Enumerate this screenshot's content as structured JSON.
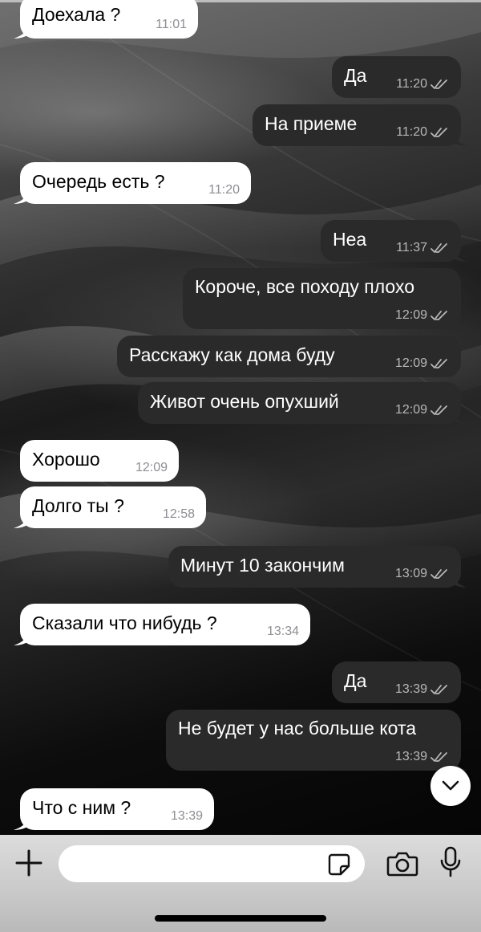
{
  "chat": {
    "messages": [
      {
        "dir": "in",
        "text": "Доехала ?",
        "time": "11:01"
      },
      {
        "dir": "out",
        "text": "Да",
        "time": "11:20"
      },
      {
        "dir": "out",
        "text": "На приеме",
        "time": "11:20"
      },
      {
        "dir": "in",
        "text": "Очередь есть ?",
        "time": "11:20"
      },
      {
        "dir": "out",
        "text": "Неа",
        "time": "11:37"
      },
      {
        "dir": "out",
        "text": "Короче, все походу плохо",
        "time": "12:09"
      },
      {
        "dir": "out",
        "text": "Расскажу как дома буду",
        "time": "12:09"
      },
      {
        "dir": "out",
        "text": "Живот очень опухший",
        "time": "12:09"
      },
      {
        "dir": "in",
        "text": "Хорошо",
        "time": "12:09"
      },
      {
        "dir": "in",
        "text": "Долго ты ?",
        "time": "12:58"
      },
      {
        "dir": "out",
        "text": "Минут 10 закончим",
        "time": "13:09"
      },
      {
        "dir": "in",
        "text": "Сказали что нибудь ?",
        "time": "13:34"
      },
      {
        "dir": "out",
        "text": "Да",
        "time": "13:39"
      },
      {
        "dir": "out",
        "text": "Не будет у нас больше кота",
        "time": "13:39"
      },
      {
        "dir": "in",
        "text": "Что с ним ?",
        "time": "13:39"
      }
    ],
    "read_status_icon": "double-check-icon"
  },
  "composer": {
    "input_value": "",
    "input_placeholder": "",
    "icons": [
      "plus-icon",
      "sticker-icon",
      "camera-icon",
      "microphone-icon"
    ]
  },
  "scroll_button_icon": "chevron-down-icon",
  "colors": {
    "incoming_bubble": "#ffffff",
    "outgoing_bubble": "#2a2a2a",
    "composer_bar": "#d0d0d0"
  }
}
